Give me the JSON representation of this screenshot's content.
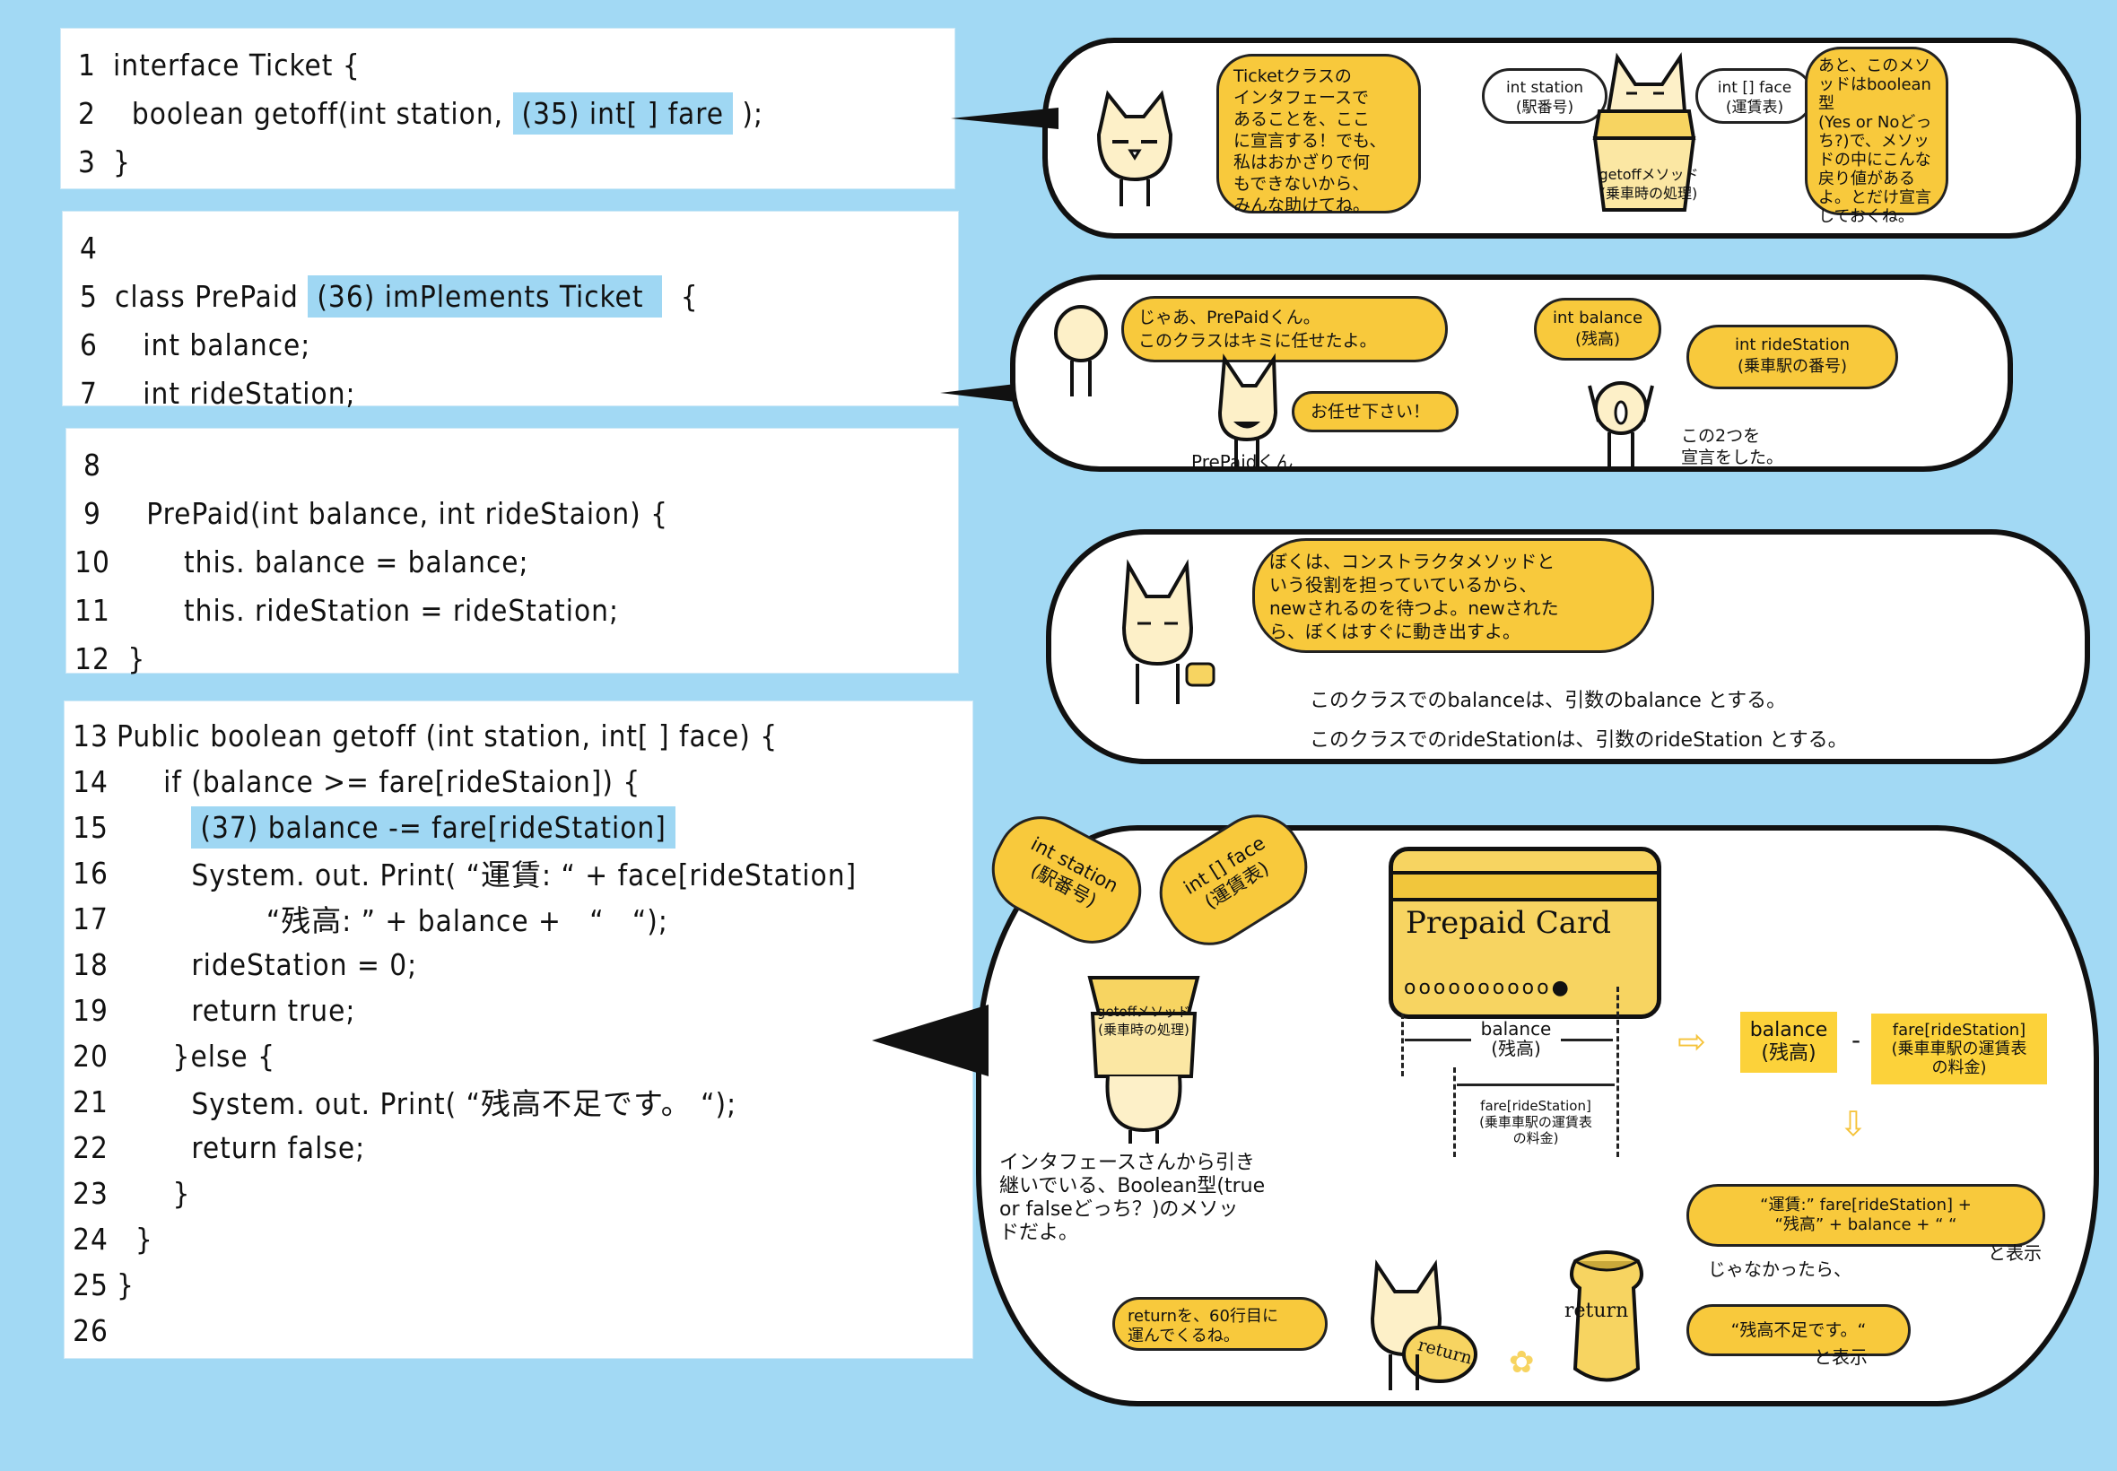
{
  "colors": {
    "background": "#a2d9f4",
    "code_highlight": "#9fd7f3",
    "bubble_yellow": "#f8c93c",
    "box_yellow": "#fcd23a",
    "ink": "#111111"
  },
  "code_blocks": [
    {
      "lines": [
        {
          "num": "1",
          "text": "interface Ticket {"
        },
        {
          "num": "2",
          "text": "  boolean getoff(int station, ",
          "highlight": "(35) int[ ] fare",
          "after": " );"
        },
        {
          "num": "3",
          "text": "}"
        }
      ]
    },
    {
      "lines": [
        {
          "num": "4",
          "text": ""
        },
        {
          "num": "5",
          "text": "class PrePaid ",
          "highlight": "(36) imPlements Ticket ",
          "after": "  {"
        },
        {
          "num": "6",
          "text": "   int balance;"
        },
        {
          "num": "7",
          "text": "   int rideStation;"
        }
      ]
    },
    {
      "lines": [
        {
          "num": "8",
          "text": ""
        },
        {
          "num": "9",
          "text": "   PrePaid(int balance, int rideStaion) {"
        },
        {
          "num": "10",
          "text": "       this. balance = balance;"
        },
        {
          "num": "11",
          "text": "       this. rideStation = rideStation;"
        },
        {
          "num": "12",
          "text": " }"
        }
      ]
    },
    {
      "lines": [
        {
          "num": "13",
          "text": "Public boolean getoff (int station, int[ ] face) {"
        },
        {
          "num": "14",
          "text": "     if (balance >= fare[rideStaion]) {"
        },
        {
          "num": "15",
          "text": "        ",
          "highlight": "(37) balance -= fare[rideStation]",
          "after": ""
        },
        {
          "num": "16",
          "text": "        System. out. Print( “運賃: “ + face[rideStation]"
        },
        {
          "num": "17",
          "text": "                “残高: ” + balance +   “   “);"
        },
        {
          "num": "18",
          "text": "        rideStation = 0;"
        },
        {
          "num": "19",
          "text": "        return true;"
        },
        {
          "num": "20",
          "text": "      }else {"
        },
        {
          "num": "21",
          "text": "        System. out. Print( “残高不足です。 “);"
        },
        {
          "num": "22",
          "text": "        return false;"
        },
        {
          "num": "23",
          "text": "      }"
        },
        {
          "num": "24",
          "text": "  }"
        },
        {
          "num": "25",
          "text": "}"
        },
        {
          "num": "26",
          "text": ""
        }
      ]
    }
  ],
  "panel1": {
    "cat_speech": "Ticketクラスの\nインタフェースで\nあることを、ここ\nに宣言する！でも、\n私はおかざりで何\nもできないから、\nみんな助けてね。",
    "param1": "int station\n(駅番号)",
    "param2": "int [] face\n(運賃表)",
    "box_label": "getoffメソッド\n(乗車時の処理)",
    "right_speech": "あと、このメソ\nッドはboolean型\n(Yes or Noどっ\nち?)で、メソッ\nドの中にこんな\n戻り値がある\nよ。とだけ宣言\nしておくね。"
  },
  "panel2": {
    "speech1": "じゃあ、PrePaidくん。\nこのクラスはキミに任せたよ。",
    "speech2": "お任せ下さい！",
    "character_name": "PrePaidくん",
    "var1": "int balance\n(残高)",
    "var2": "int rideStation\n(乗車駅の番号)",
    "caption": "この2つを\n宣言をした。"
  },
  "panel3": {
    "speech": "ぼくは、コンストラクタメソッドと\nいう役割を担っていているから、\nnewされるのを待つよ。newされた\nら、ぼくはすぐに動き出すよ。",
    "note1": "このクラスでのbalanceは、引数のbalance とする。",
    "note2": "このクラスでのrideStationは、引数のrideStation とする。"
  },
  "panel4": {
    "param1": "int station\n(駅番号)",
    "param2": "int [] face\n(運賃表)",
    "box_label": "getoffメソッド\n(乗車時の処理)",
    "card_title": "Prepaid  Card",
    "card_holes": "oooooooooo●",
    "balance_dim": "balance\n(残高)",
    "fare_dim": "fare[rideStation]\n(乗車車駅の運賃表\nの料金)",
    "formula_left": "balance\n(残高)",
    "formula_op": "-",
    "formula_right": "fare[rideStation]\n(乗車車駅の運賃表\nの料金)",
    "inherit_note": "インタフェースさんから引き\n継いでいる、Boolean型(true\nor falseどっち？)のメソッ\nドだよ。",
    "output_true": "“運賃:” fare[rideStation] +\n“残高”  + balance +  “  “",
    "output_true_suffix": "と表示",
    "else_label": "じゃなかったら、",
    "output_false": "“残高不足です。“",
    "output_false_suffix": "と表示",
    "return_note": "returnを、60行目に\n運んでくるね。",
    "bag_label": "return",
    "carried_label": "return"
  }
}
